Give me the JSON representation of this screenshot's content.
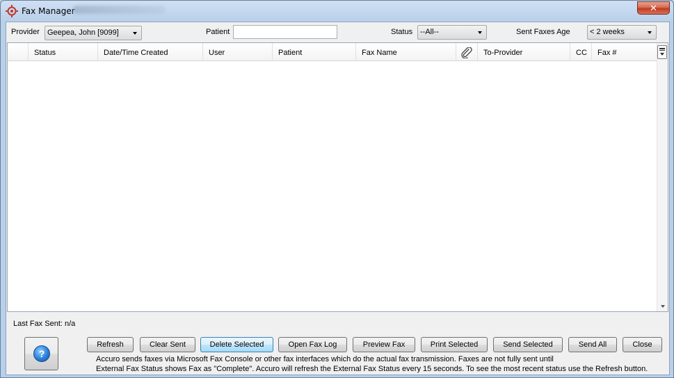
{
  "window": {
    "title": "Fax Manager",
    "close_glyph": "✕"
  },
  "filters": {
    "provider_label": "Provider",
    "provider_value": "Geepea, John [9099]",
    "patient_label": "Patient",
    "patient_value": "",
    "status_label": "Status",
    "status_value": "--All--",
    "age_label": "Sent Faxes Age",
    "age_value": "< 2 weeks"
  },
  "grid": {
    "columns": [
      "Status",
      "Date/Time Created",
      "User",
      "Patient",
      "Fax Name",
      "To-Provider",
      "CC",
      "Fax #"
    ],
    "attachment_icon": "paperclip-icon",
    "rows": []
  },
  "footer": {
    "last_fax_label": "Last Fax Sent: n/a",
    "help_glyph": "?",
    "buttons": {
      "refresh": "Refresh",
      "clear_sent": "Clear Sent",
      "delete_selected": "Delete Selected",
      "open_fax_log": "Open Fax Log",
      "preview_fax": "Preview Fax",
      "print_selected": "Print Selected",
      "send_selected": "Send Selected",
      "send_all": "Send All",
      "close": "Close"
    },
    "note_line1": "Accuro sends faxes via Microsoft Fax Console or other fax interfaces which do the actual fax transmission. Faxes are not fully sent until",
    "note_line2": "External Fax Status shows Fax as \"Complete\". Accuro will refresh the External Fax Status every 15 seconds. To see the most recent status use the Refresh button."
  },
  "colors": {
    "title_bar": "#b9d0ea",
    "panel": "#f0f0f0",
    "close_button": "#c33a22",
    "focused_button": "#bee6fd",
    "help_icon": "#2a7fd6"
  }
}
